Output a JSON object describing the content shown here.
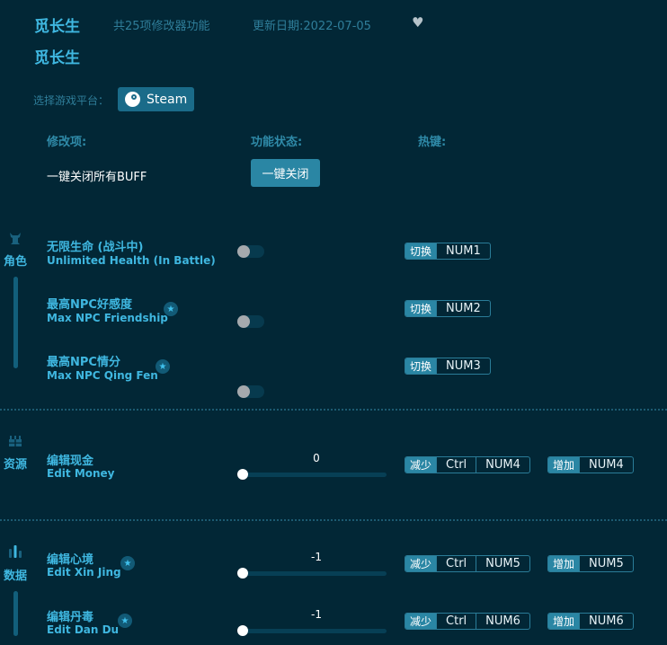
{
  "header": {
    "title": "觅长生",
    "feature_count": "共25项修改器功能",
    "update_date": "更新日期:2022-07-05",
    "favorite_icon": "heart-icon",
    "subtitle": "觅长生"
  },
  "platform": {
    "label": "选择游戏平台：",
    "selected": "Steam",
    "icon": "steam-icon"
  },
  "columns": {
    "item": "修改项:",
    "status": "功能状态:",
    "hotkey": "热键:"
  },
  "close_all": {
    "label": "一键关闭所有BUFF",
    "button": "一键关闭"
  },
  "categories": [
    {
      "name": "角色",
      "icon": "character-icon",
      "items": [
        {
          "cn": "无限生命 (战斗中)",
          "en": "Unlimited Health (In Battle)",
          "starred": false,
          "type": "toggle",
          "on": false,
          "hotkey": {
            "action": "切换",
            "keys": [
              "NUM1"
            ]
          }
        },
        {
          "cn": "最高NPC好感度",
          "en": "Max NPC Friendship",
          "starred": true,
          "type": "toggle",
          "on": false,
          "hotkey": {
            "action": "切换",
            "keys": [
              "NUM2"
            ]
          }
        },
        {
          "cn": "最高NPC情分",
          "en": "Max NPC Qing Fen",
          "starred": true,
          "type": "toggle",
          "on": false,
          "hotkey": {
            "action": "切换",
            "keys": [
              "NUM3"
            ]
          }
        }
      ]
    },
    {
      "name": "资源",
      "icon": "resources-icon",
      "items": [
        {
          "cn": "编辑现金",
          "en": "Edit Money",
          "starred": false,
          "type": "slider",
          "value": "0",
          "dec": {
            "action": "减少",
            "keys": [
              "Ctrl",
              "NUM4"
            ]
          },
          "inc": {
            "action": "增加",
            "keys": [
              "NUM4"
            ]
          }
        }
      ]
    },
    {
      "name": "数据",
      "icon": "data-icon",
      "items": [
        {
          "cn": "编辑心境",
          "en": "Edit Xin Jing",
          "starred": true,
          "type": "slider",
          "value": "-1",
          "dec": {
            "action": "减少",
            "keys": [
              "Ctrl",
              "NUM5"
            ]
          },
          "inc": {
            "action": "增加",
            "keys": [
              "NUM5"
            ]
          }
        },
        {
          "cn": "编辑丹毒",
          "en": "Edit Dan Du",
          "starred": true,
          "type": "slider",
          "value": "-1",
          "dec": {
            "action": "减少",
            "keys": [
              "Ctrl",
              "NUM6"
            ]
          },
          "inc": {
            "action": "增加",
            "keys": [
              "NUM6"
            ]
          }
        }
      ]
    }
  ],
  "colors": {
    "background": "#022736",
    "accent": "#3fb7e0",
    "button": "#2a86a4"
  }
}
